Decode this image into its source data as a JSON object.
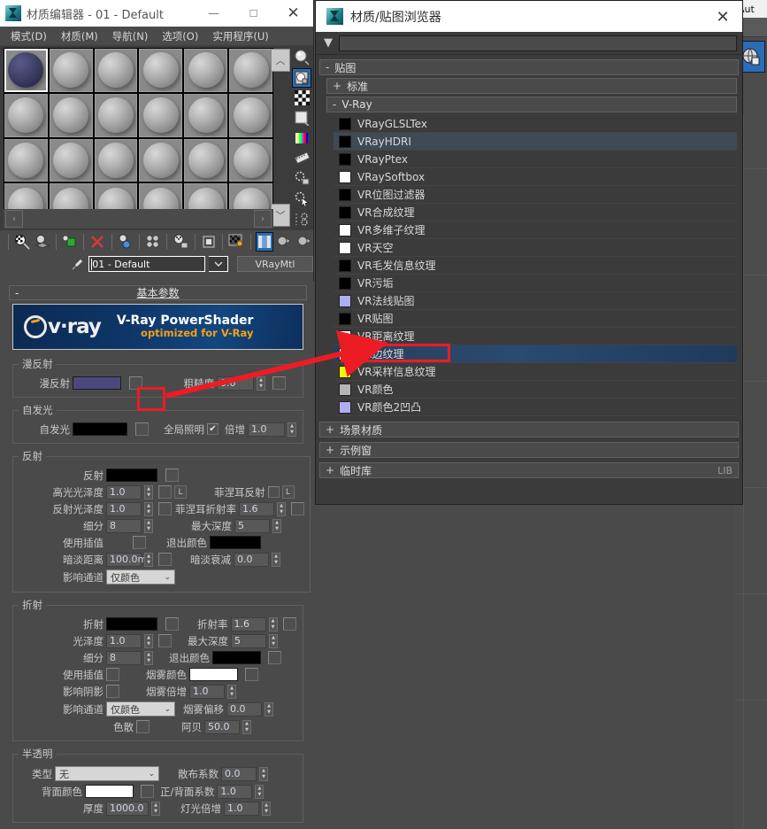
{
  "material_editor": {
    "title": "材质编辑器 - 01 - Default",
    "window_buttons": {
      "minimize": "—",
      "maximize": "☐",
      "close": "✕"
    },
    "menus": [
      {
        "label": "模式(D)"
      },
      {
        "label": "材质(M)"
      },
      {
        "label": "导航(N)"
      },
      {
        "label": "选项(O)"
      },
      {
        "label": "实用程序(U)"
      }
    ],
    "slot_count": 24,
    "active_slot": 1,
    "nav": {
      "up": "︿",
      "down": "﹀",
      "prev": "‹",
      "next": "›"
    },
    "name_field": {
      "value": "01 - Default",
      "placeholder": ""
    },
    "material_type": "VRayMtl"
  },
  "basic_params": {
    "rollout_title": "基本参数",
    "collapse": "-",
    "banner": {
      "brand": "v·ray",
      "line1": "V-Ray PowerShader",
      "line2": "optimized for V-Ray"
    },
    "diffuse": {
      "group": "漫反射",
      "label": "漫反射",
      "color": "#4b4880",
      "roughness_label": "粗糙度",
      "roughness_value": "0.0"
    },
    "selfillum": {
      "group": "自发光",
      "label": "自发光",
      "color": "#000000",
      "gi_label": "全局照明",
      "gi_checked": "✔",
      "mult_label": "倍增",
      "mult_value": "1.0"
    },
    "reflection": {
      "group": "反射",
      "refl_label": "反射",
      "refl_color": "#000000",
      "hilight_gloss_label": "高光光泽度",
      "hilight_gloss_value": "1.0",
      "hilight_L": "L",
      "fresnel_label": "菲涅耳反射",
      "fresnel_L": "L",
      "refl_gloss_label": "反射光泽度",
      "refl_gloss_value": "1.0",
      "fresnel_ior_label": "菲涅耳折射率",
      "fresnel_ior_value": "1.6",
      "subdivs_label": "细分",
      "subdivs_value": "8",
      "maxdepth_label": "最大深度",
      "maxdepth_value": "5",
      "interp_label": "使用插值",
      "exit_color_label": "退出颜色",
      "exit_color": "#000000",
      "dim_dist_label": "暗淡距离",
      "dim_dist_value": "100.0m",
      "dim_fall_label": "暗淡衰减",
      "dim_fall_value": "0.0",
      "channel_label": "影响通道",
      "channel_value": "仅颜色"
    },
    "refraction": {
      "group": "折射",
      "refr_label": "折射",
      "refr_color": "#000000",
      "ior_label": "折射率",
      "ior_value": "1.6",
      "gloss_label": "光泽度",
      "gloss_value": "1.0",
      "maxdepth_label": "最大深度",
      "maxdepth_value": "5",
      "subdivs_label": "细分",
      "subdivs_value": "8",
      "exit_color_label": "退出颜色",
      "exit_color": "#000000",
      "interp_label": "使用插值",
      "fog_color_label": "烟雾颜色",
      "fog_color": "#ffffff",
      "shadows_label": "影响阴影",
      "fog_mult_label": "烟雾倍增",
      "fog_mult_value": "1.0",
      "channel_label": "影响通道",
      "channel_value": "仅颜色",
      "fog_bias_label": "烟雾偏移",
      "fog_bias_value": "0.0",
      "dispersion_label": "色散",
      "abbe_label": "阿贝",
      "abbe_value": "50.0"
    },
    "translucency": {
      "group": "半透明",
      "type_label": "类型",
      "type_value": "无",
      "scatter_label": "散布系数",
      "scatter_value": "0.0",
      "back_color_label": "背面颜色",
      "back_color": "#ffffff",
      "fb_label": "正/背面系数",
      "fb_value": "1.0",
      "thickness_label": "厚度",
      "thickness_value": "1000.0",
      "light_mult_label": "灯光倍增",
      "light_mult_value": "1.0"
    }
  },
  "browser": {
    "title": "材质/贴图浏览器",
    "close": "✕",
    "search_placeholder": "",
    "search_value": "",
    "funnel_icon": "filter-icon",
    "sections": [
      {
        "label": "贴图",
        "state": "-"
      },
      {
        "label": "标准",
        "state": "+"
      },
      {
        "label": "V-Ray",
        "state": "-"
      }
    ],
    "maps": [
      {
        "label": "VRayGLSLTex",
        "swatch": "#000000",
        "state": "normal"
      },
      {
        "label": "VRayHDRI",
        "swatch": "#000000",
        "state": "hover"
      },
      {
        "label": "VRayPtex",
        "swatch": "#000000",
        "state": "normal"
      },
      {
        "label": "VRaySoftbox",
        "swatch": "#ffffff",
        "state": "normal"
      },
      {
        "label": "VR位图过滤器",
        "swatch": "#000000",
        "state": "normal"
      },
      {
        "label": "VR合成纹理",
        "swatch": "#000000",
        "state": "normal"
      },
      {
        "label": "VR多维子纹理",
        "swatch": "#ffffff",
        "state": "normal"
      },
      {
        "label": "VR天空",
        "swatch": "#ffffff",
        "state": "normal"
      },
      {
        "label": "VR毛发信息纹理",
        "swatch": "#000000",
        "state": "normal"
      },
      {
        "label": "VR污垢",
        "swatch": "#000000",
        "state": "normal"
      },
      {
        "label": "VR法线贴图",
        "swatch": "#aeaef5",
        "state": "normal"
      },
      {
        "label": "VR贴图",
        "swatch": "#000000",
        "state": "normal"
      },
      {
        "label": "VR距离纹理",
        "swatch": "#ffffff",
        "state": "normal"
      },
      {
        "label": "VR边纹理",
        "swatch": "#ffffff",
        "state": "selected"
      },
      {
        "label": "VR采样信息纹理",
        "swatch": "#f5f500",
        "state": "normal"
      },
      {
        "label": "VR颜色",
        "swatch": "#b5b5b5",
        "state": "normal"
      },
      {
        "label": "VR颜色2凹凸",
        "swatch": "#aeaef5",
        "state": "normal"
      }
    ],
    "footer_sections": [
      {
        "label": "场景材质",
        "state": "+",
        "tag": ""
      },
      {
        "label": "示例窗",
        "state": "+",
        "tag": ""
      },
      {
        "label": "临时库",
        "state": "+",
        "tag": "LIB"
      }
    ]
  },
  "background": {
    "label": "Aut"
  },
  "annotation": {
    "color": "#ec1c24",
    "target_map": "VR边纹理",
    "source_control": "漫反射贴图按钮"
  }
}
